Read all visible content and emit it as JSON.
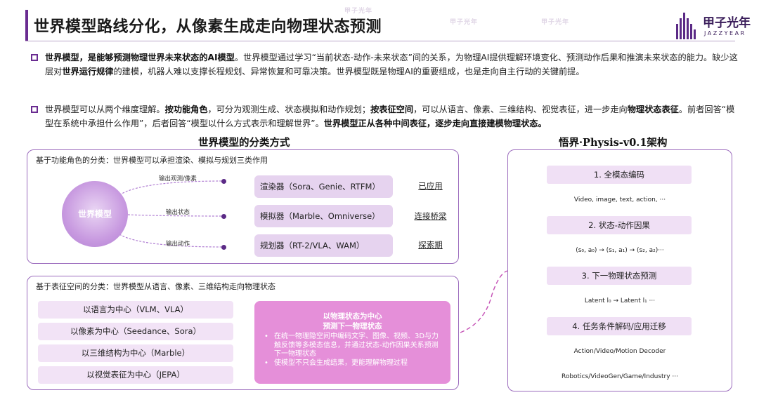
{
  "header": {
    "title": "世界模型路线分化，从像素生成走向物理状态预测",
    "logo_cn": "甲子光年",
    "logo_en": "JAZZYEAR"
  },
  "bullets": [
    {
      "parts": [
        {
          "t": "世界模型，是能够预测物理世界未来状态的AI模型",
          "b": true
        },
        {
          "t": "。世界模型通过学习“当前状态-动作-未来状态”间的关系，为物理AI提供理解环境变化、预测动作后果和推演未来状态的能力。缺少这层对",
          "b": false
        },
        {
          "t": "世界运行规律",
          "b": true
        },
        {
          "t": "的建模，机器人难以支撑长程规划、异常恢复和可靠决策。世界模型既是物理AI的重要组成，也是走向自主行动的关键前提。",
          "b": false
        }
      ]
    },
    {
      "parts": [
        {
          "t": "世界模型可以从两个维度理解。",
          "b": false
        },
        {
          "t": "按功能角色",
          "b": true
        },
        {
          "t": "，可分为观测生成、状态模拟和动作规划；",
          "b": false
        },
        {
          "t": "按表征空间",
          "b": true
        },
        {
          "t": "，可以从语言、像素、三维结构、视觉表征，进一步走向",
          "b": false
        },
        {
          "t": "物理状态表征",
          "b": true
        },
        {
          "t": "。前者回答“模型在系统中承担什么作用”，后者回答“模型以什么方式表示和理解世界”。",
          "b": false
        },
        {
          "t": "世界模型正从各种中间表征，逐步走向直接建模物理状态。",
          "b": true
        }
      ]
    }
  ],
  "classification": {
    "title": "世界模型的分类方式",
    "function_panel": {
      "label": "基于功能角色的分类：世界模型可以承担渲染、模拟与规划三类作用",
      "center": "世界模型",
      "outputs": [
        "输出观测/像素",
        "输出状态",
        "输出动作"
      ],
      "roles": [
        {
          "name": "渲染器（Sora、Genie、RTFM）",
          "status": "已应用"
        },
        {
          "name": "模拟器（Marble、Omniverse）",
          "status": "连接桥梁"
        },
        {
          "name": "规划器（RT-2/VLA、WAM）",
          "status": "探索期"
        }
      ]
    },
    "representation_panel": {
      "label": "基于表征空间的分类：世界模型从语言、像素、三维结构走向物理状态",
      "items": [
        "以语言为中心（VLM、VLA）",
        "以像素为中心（Seedance、Sora）",
        "以三维结构为中心（Marble）",
        "以视觉表征为中心（JEPA）"
      ],
      "highlight": {
        "title1": "以物理状态为中心",
        "title2": "预测下一物理状态",
        "points": [
          "在统一物理隐空间中编码文字、图像、视频、3D与力触反馈等多模态信息，并通过状态-动作因果关系预测下一物理状态",
          "使模型不只会生成结果，更能理解物理过程"
        ]
      }
    }
  },
  "architecture": {
    "title": "悟界·Physis-v0.1架构",
    "steps": [
      {
        "label": "1. 全模态编码",
        "sub": "Video, image, text, action, ···"
      },
      {
        "label": "2. 状态-动作因果",
        "sub": "(s₀, a₀) → (s₁, a₁) → (s₂, a₂)···"
      },
      {
        "label": "3. 下一物理状态预测",
        "sub": "Latent l₀ → Latent l₁ ···"
      },
      {
        "label": "4. 任务条件解码/应用迁移",
        "sub": "Action/Video/Motion Decoder",
        "sub2": "Robotics/VideoGen/Game/Industry ···"
      }
    ]
  },
  "watermark": "甲子光年",
  "colors": {
    "accent": "#6a2c91",
    "highlight": "#e58fd9",
    "panel_border": "#9b6bbd"
  }
}
